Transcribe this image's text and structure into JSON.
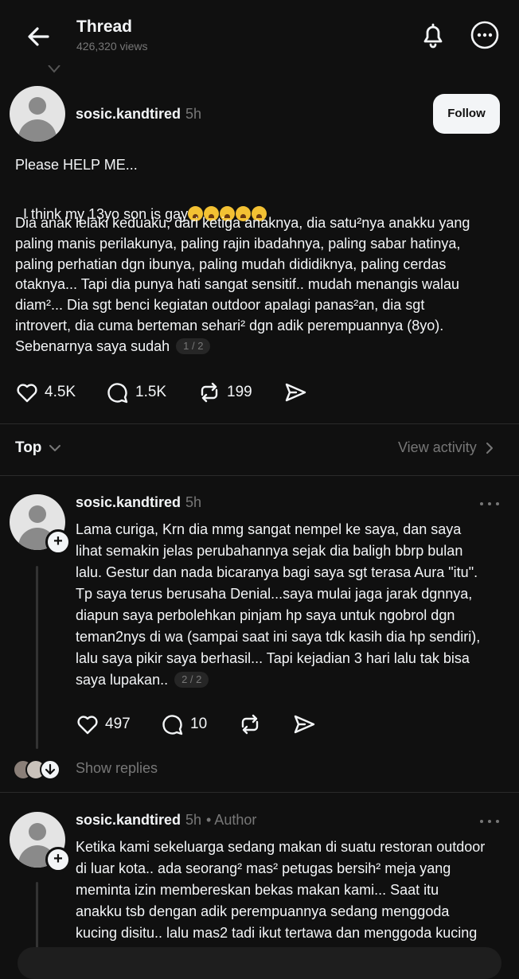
{
  "header": {
    "title": "Thread",
    "views": "426,320 views"
  },
  "main_post": {
    "username": "sosic.kandtired",
    "time": "5h",
    "follow_label": "Follow",
    "line1": "Please HELP ME...",
    "line2_text": "I think my 13yo son is gay",
    "body_lines": [
      "Dia anak lelaki keduaku, dari ketiga anaknya, dia satu²nya anakku yang",
      "paling manis perilakunya, paling rajin ibadahnya, paling sabar hatinya,",
      "paling perhatian dgn ibunya, paling mudah dididiknya, paling cerdas",
      "otaknya... Tapi dia punya hati sangat sensitif.. mudah menangis walau",
      "diam²... Dia sgt benci kegiatan outdoor apalagi panas²an, dia sgt",
      "introvert, dia cuma berteman sehari² dgn adik perempuannya (8yo).",
      "Sebenarnya saya sudah"
    ],
    "pager": "1 / 2",
    "likes": "4.5K",
    "comments": "1.5K",
    "reposts": "199"
  },
  "sort": {
    "label": "Top",
    "view_activity": "View activity"
  },
  "reply1": {
    "username": "sosic.kandtired",
    "time": "5h",
    "body_lines": [
      "Lama curiga, Krn dia mmg sangat nempel ke saya, dan saya",
      "lihat semakin jelas perubahannya sejak dia baligh bbrp bulan",
      "lalu. Gestur dan nada bicaranya bagi saya sgt terasa Aura \"itu\".",
      "Tp saya terus berusaha Denial...saya mulai jaga jarak dgnnya,",
      "diapun saya perbolehkan pinjam hp saya untuk ngobrol dgn",
      "teman2nys di wa (sampai saat ini saya tdk kasih dia hp sendiri),",
      "lalu saya pikir saya berhasil... Tapi kejadian 3 hari lalu tak bisa",
      "saya lupakan.."
    ],
    "pager": "2 / 2",
    "likes": "497",
    "comments": "10",
    "show_replies": "Show replies"
  },
  "reply2": {
    "username": "sosic.kandtired",
    "time": "5h",
    "author_tag": "• Author",
    "body_lines": [
      "Ketika kami sekeluarga sedang makan di suatu restoran outdoor",
      "di luar kota.. ada seorang² mas² petugas bersih² meja yang",
      "meminta izin membereskan bekas makan kami... Saat itu",
      "anakku tsb dengan adik perempuannya sedang menggoda",
      "kucing disitu.. lalu mas2 tadi ikut tertawa dan menggoda kucing"
    ]
  },
  "icons": {
    "back": "arrow-left-icon",
    "bell": "bell-icon",
    "more": "more-circle-icon",
    "like": "heart-icon",
    "comment": "comment-icon",
    "repost": "repost-icon",
    "share": "send-icon"
  },
  "colors": {
    "background": "#101010",
    "text": "#f3f5f7",
    "muted": "#777777"
  }
}
